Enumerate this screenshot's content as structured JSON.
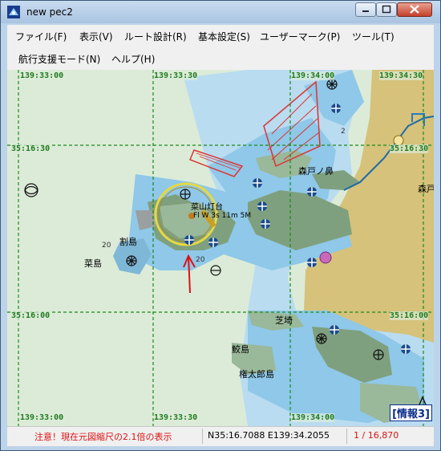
{
  "window": {
    "title": "new pec2"
  },
  "menu": {
    "items": [
      {
        "label": "ファイル(F)"
      },
      {
        "label": "表示(V)"
      },
      {
        "label": "ルート設計(R)"
      },
      {
        "label": "基本設定(S)"
      },
      {
        "label": "ユーザーマーク(P)"
      },
      {
        "label": "ツール(T)"
      },
      {
        "label": "航行支援モード(N)"
      },
      {
        "label": "ヘルプ(H)"
      }
    ]
  },
  "map": {
    "grid_labels": {
      "top": [
        "139:33:00",
        "139:33:30",
        "139:34:00",
        "139:34:30"
      ],
      "bottom": [
        "139:33:00",
        "139:33:30",
        "139:34:00"
      ],
      "left": [
        "35:16:30",
        "35:16:00"
      ],
      "right": [
        "35:16:30",
        "35:16:00"
      ]
    },
    "places": {
      "morito_bana": "森戸ノ鼻",
      "morito": "森戸",
      "nayama_lighthouse": "菜山灯台",
      "light_char": "Fl W 3s 11m 5M",
      "warishima": "割島",
      "najima": "菜島",
      "shibasaki": "芝埼",
      "samejima": "鮫島",
      "gontaroujima": "権太郎島"
    },
    "depths": [
      "20",
      "2",
      "20"
    ],
    "info_button": "[情報3]",
    "colors": {
      "land": "#d6c27a",
      "shallow": "#8fc8e8",
      "deep": "#dcebd8",
      "green_area": "#7fa07f",
      "grid": "#1a8a1a"
    }
  },
  "status": {
    "warning": "注意！現在元図縮尺の2.1倍の表示",
    "position": "N35:16.7088 E139:34.2055",
    "scale": "1 / 16,870"
  }
}
